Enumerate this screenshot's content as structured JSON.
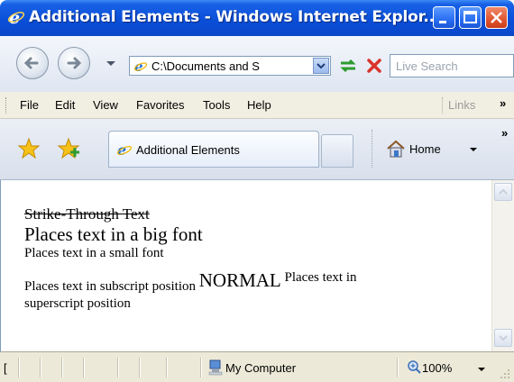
{
  "window": {
    "title": "Additional Elements - Windows Internet Explor...",
    "minimize_icon": "minimize-icon",
    "maximize_icon": "maximize-icon",
    "close_icon": "close-icon"
  },
  "navigation": {
    "address": "C:\\Documents and S",
    "search_placeholder": "Live Search"
  },
  "menu": {
    "items": [
      "File",
      "Edit",
      "View",
      "Favorites",
      "Tools",
      "Help"
    ],
    "links_label": "Links",
    "overflow": "»"
  },
  "tabs": {
    "active_tab_label": "Additional Elements",
    "home_label": "Home",
    "overflow": "»"
  },
  "document": {
    "strike_text": "Strike-Through Text",
    "big_text": "Places text in a big font",
    "small_text": "Places text in a small font",
    "subscript_text": "Places text in subscript position",
    "normal_text": "NORMAL",
    "superscript_text_1": "Places text in",
    "superscript_text_2": "superscript position"
  },
  "status": {
    "left_text": "[",
    "zone": "My Computer",
    "zoom": "100%"
  },
  "colors": {
    "titlebar": "#0a4fd8",
    "close_button": "#e05530",
    "menubar": "#f1efe2",
    "statusbar": "#ece9d8"
  }
}
